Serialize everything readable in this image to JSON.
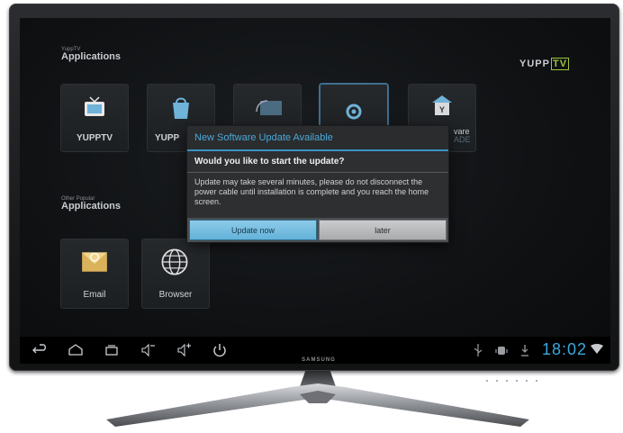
{
  "header": {
    "apps_small": "YuppTV",
    "apps_title": "Applications",
    "other_small": "Other Popular",
    "other_title": "Applications",
    "logo_text": "YUPP",
    "logo_tv": "TV"
  },
  "apps": [
    {
      "label": "YUPPTV",
      "icon": "tv-icon"
    },
    {
      "label": "YUPP",
      "icon": "shopping-bag-icon"
    },
    {
      "label": "",
      "icon": "screen-cast-icon"
    },
    {
      "label": "",
      "icon": "gear-icon"
    },
    {
      "label_right": "vare",
      "label_right2": "ADE",
      "icon": "update-icon"
    }
  ],
  "other_apps": [
    {
      "label": "Email",
      "icon": "email-icon"
    },
    {
      "label": "Browser",
      "icon": "globe-icon"
    }
  ],
  "dialog": {
    "title": "New Software Update Available",
    "question": "Would you like to start the update?",
    "body": "Update may take several minutes, please do not disconnect the power cable until installation is complete and you reach the home screen.",
    "primary_button": "Update now",
    "secondary_button": "later"
  },
  "statusbar": {
    "clock": "18:02"
  },
  "tv": {
    "brand": "SAMSUNG"
  },
  "colors": {
    "accent": "#3aa8de",
    "yupp_green": "#9fc53b"
  }
}
